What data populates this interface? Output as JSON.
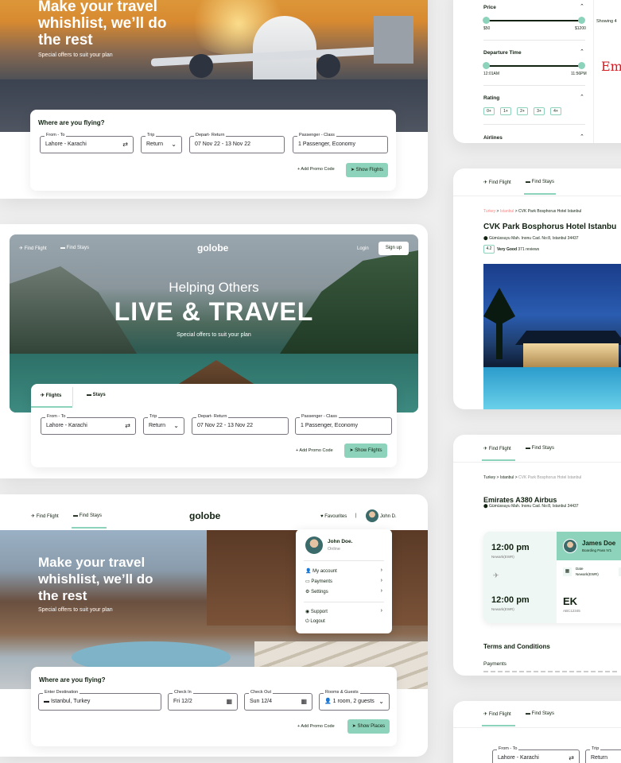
{
  "card1": {
    "hero_line1": "Make your travel",
    "hero_line2": "whishlist, we’ll do",
    "hero_line3": "the rest",
    "hero_sub": "Special offers to suit your plan",
    "search_title": "Where are you flying?",
    "from_to_label": "From - To",
    "from_to_value": "Lahore - Karachi",
    "trip_label": "Trip",
    "trip_value": "Return",
    "depart_label": "Depart- Return",
    "depart_value": "07 Nov 22 - 13 Nov 22",
    "passenger_label": "Passenger - Class",
    "passenger_value": "1 Passenger, Economy",
    "promo": "+ Add Promo Code",
    "show_button": "Show Flights"
  },
  "card2": {
    "nav_flight": "Find Flight",
    "nav_stays": "Find Stays",
    "logo": "golobe",
    "login": "Login",
    "signup": "Sign up",
    "hero_sub_top": "Helping Others",
    "hero_main": "LIVE & TRAVEL",
    "hero_sub": "Special offers to suit your plan",
    "tab_flights": "Flights",
    "tab_stays": "Stays",
    "from_to_label": "From - To",
    "from_to_value": "Lahore - Karachi",
    "trip_label": "Trip",
    "trip_value": "Return",
    "depart_label": "Depart- Return",
    "depart_value": "07 Nov 22 - 13 Nov 22",
    "passenger_label": "Passenger - Class",
    "passenger_value": "1 Passenger, Economy",
    "promo": "+ Add Promo Code",
    "show_button": "Show Filghts"
  },
  "card3": {
    "nav_flight": "Find Flight",
    "nav_stays": "Find Stays",
    "logo": "golobe",
    "favourites": "Favourites",
    "separator": "|",
    "user_short": "John D.",
    "hero_line1": "Make your travel",
    "hero_line2": "whishlist, we’ll do",
    "hero_line3": "the rest",
    "hero_sub": "Special offers to suit your plan",
    "menu_name": "John Doe.",
    "menu_status": "Online",
    "menu_account": "My account",
    "menu_payments": "Payments",
    "menu_settings": "Settings",
    "menu_support": "Support",
    "menu_logout": "Logout",
    "search_title": "Where are you flying?",
    "dest_label": "Enter Destination",
    "dest_value": "Istanbul, Turkey",
    "checkin_label": "Check In",
    "checkin_value": "Fri 12/2",
    "checkout_label": "Check Out",
    "checkout_value": "Sun 12/4",
    "rooms_label": "Rooms & Guests",
    "rooms_value": "1 room, 2 guests",
    "promo": "+ Add Promo Code",
    "show_button": "Show Places"
  },
  "filters": {
    "price": "Price",
    "price_min": "$50",
    "price_max": "$1200",
    "departure": "Departure Time",
    "dep_min": "12:01AM",
    "dep_max": "11:56PM",
    "rating": "Rating",
    "ratings": [
      "0+",
      "1+",
      "2+",
      "3+",
      "4+"
    ],
    "airlines": "Airlines",
    "showing": "Showing 4",
    "emirates_partial": "Emi"
  },
  "hotel": {
    "nav_flight": "Find Flight",
    "nav_stays": "Find Stays",
    "crumb1": "Turkey",
    "crumb2": "Istanbul",
    "crumb3": "CVK Park Bosphorus Hotel Istanbul",
    "sep": ">",
    "title": "CVK Park Bosphorus Hotel Istanbu",
    "address": "Gümüssuyu Mah. Inonu Cad. No:8, Istanbul 34437",
    "score": "4.2",
    "score_label": "Very Good",
    "reviews": "371 reviews"
  },
  "flight": {
    "nav_flight": "Find Flight",
    "nav_stays": "Find Stays",
    "crumb1": "Turkey",
    "crumb2": "Istanbul",
    "crumb3": "CVK Park Bosphorus Hotel Istanbul",
    "sep": ">",
    "title": "Emirates A380 Airbus",
    "address": "Gümüssuyu Mah. Inonu Cad. No:8, Istanbul 34437",
    "time1": "12:00 pm",
    "place1": "Newark(EWR)",
    "time2": "12:00 pm",
    "place2": "Newark(EWR)",
    "passenger": "James Doe",
    "boarding": "Boarding Pass N'1",
    "date_label": "Date",
    "date_value": "Newark(EWR)",
    "code": "EK",
    "code_sub": "ABC12345",
    "terms": "Terms and Conditions",
    "payments": "Payments"
  },
  "bottom_right": {
    "nav_flight": "Find Flight",
    "nav_stays": "Find Stays",
    "from_to_label": "From - To",
    "from_to_value": "Lahore - Karachi",
    "trip_label": "Trip",
    "trip_value": "Return"
  },
  "colors": {
    "accent": "#8dd3bb",
    "dark": "#112211",
    "breadcrumb_red": "#ff8682"
  }
}
